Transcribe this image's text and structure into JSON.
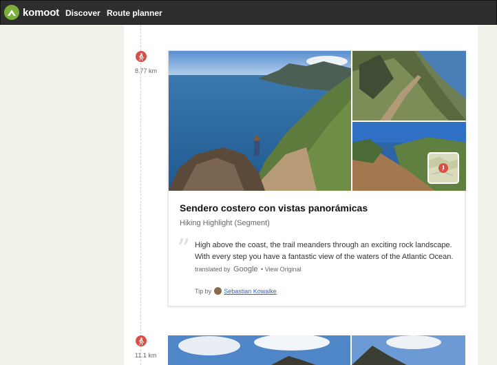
{
  "header": {
    "brand": "komoot",
    "nav": [
      "Discover",
      "Route planner"
    ]
  },
  "timeline": [
    {
      "distance": "8.77 km",
      "icon": "hiker-icon"
    },
    {
      "distance": "11.1 km",
      "icon": "hiker-icon"
    }
  ],
  "highlight": {
    "title": "Sendero costero con vistas panorámicas",
    "subtitle": "Hiking Highlight (Segment)",
    "description": "High above the coast, the trail meanders through an exciting rock landscape. With every step you have a fantastic view of the waters of the Atlantic Ocean.",
    "translated_by_prefix": "translated by",
    "translated_by_service": "Google",
    "view_original": "View Original",
    "tip_prefix": "Tip by",
    "tip_author": "Sebastian Kowalke"
  },
  "colors": {
    "header_bg": "#2e2e2e",
    "brand_green": "#7bb13b",
    "waypoint_red": "#d84f44",
    "link_blue": "#2b63c4"
  }
}
